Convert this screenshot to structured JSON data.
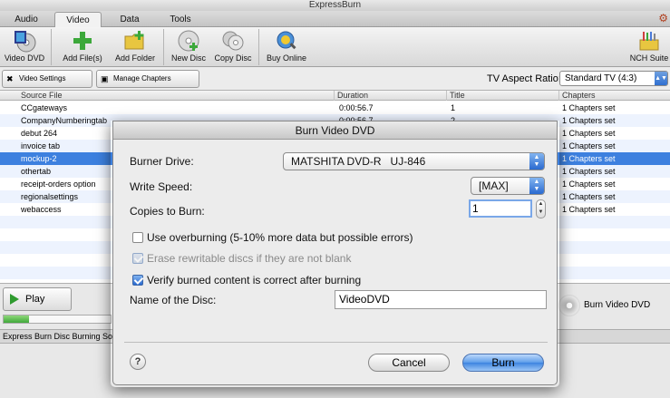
{
  "window": {
    "title": "ExpressBurn"
  },
  "tabs": [
    {
      "label": "Audio"
    },
    {
      "label": "Video"
    },
    {
      "label": "Data"
    },
    {
      "label": "Tools"
    }
  ],
  "toolbar": {
    "buttons": [
      {
        "label": "Video DVD",
        "icon": "video-dvd-icon"
      },
      {
        "label": "Add File(s)",
        "icon": "add-file-icon"
      },
      {
        "label": "Add Folder",
        "icon": "add-folder-icon"
      },
      {
        "label": "New Disc",
        "icon": "new-disc-icon"
      },
      {
        "label": "Copy Disc",
        "icon": "copy-disc-icon"
      },
      {
        "label": "Buy Online",
        "icon": "buy-online-icon"
      },
      {
        "label": "NCH Suite",
        "icon": "nch-suite-icon"
      }
    ]
  },
  "subbar": {
    "video_settings": "Video Settings",
    "manage_chapters": "Manage Chapters",
    "aspect_label": "TV Aspect Ratio:",
    "aspect_value": "Standard TV (4:3)"
  },
  "list": {
    "columns": [
      "Source File",
      "Duration",
      "Title",
      "Chapters"
    ],
    "rows": [
      {
        "file": "CCgateways",
        "duration": "0:00:56.7",
        "title": "1",
        "chapters": "1 Chapters set"
      },
      {
        "file": "CompanyNumberingtab",
        "duration": "0:00:56.7",
        "title": "2",
        "chapters": "1 Chapters set"
      },
      {
        "file": "debut 264",
        "duration": "",
        "title": "",
        "chapters": "1 Chapters set"
      },
      {
        "file": "invoice tab",
        "duration": "",
        "title": "",
        "chapters": "1 Chapters set"
      },
      {
        "file": "mockup-2",
        "duration": "",
        "title": "",
        "chapters": "1 Chapters set"
      },
      {
        "file": "othertab",
        "duration": "",
        "title": "",
        "chapters": "1 Chapters set"
      },
      {
        "file": "receipt-orders option",
        "duration": "",
        "title": "",
        "chapters": "1 Chapters set"
      },
      {
        "file": "regionalsettings",
        "duration": "",
        "title": "",
        "chapters": "1 Chapters set"
      },
      {
        "file": "webaccess",
        "duration": "",
        "title": "",
        "chapters": "1 Chapters set"
      }
    ],
    "selected_index": 4
  },
  "bottom": {
    "play_label": "Play",
    "progress_fraction": 0.24,
    "status_text": "Express Burn Disc Burning Software",
    "burn_video_dvd": "Burn Video DVD"
  },
  "dialog": {
    "title": "Burn Video DVD",
    "burner_label": "Burner Drive:",
    "burner_value": "MATSHITA DVD-R   UJ-846",
    "speed_label": "Write Speed:",
    "speed_value": "[MAX]",
    "copies_label": "Copies to Burn:",
    "copies_value": "1",
    "overburn_label": "Use overburning (5-10% more data but possible errors)",
    "overburn_checked": false,
    "erase_label": "Erase rewritable discs if they are not blank",
    "erase_checked": true,
    "verify_label": "Verify burned content is correct after burning",
    "verify_checked": true,
    "disc_name_label": "Name of the Disc:",
    "disc_name_value": "VideoDVD",
    "help_label": "?",
    "cancel_label": "Cancel",
    "burn_label": "Burn"
  },
  "colors": {
    "selection": "#3d80df",
    "row_alt": "#edf3fe",
    "accent_blue": "#2a6ad0",
    "progress_green": "#3fa83a"
  }
}
